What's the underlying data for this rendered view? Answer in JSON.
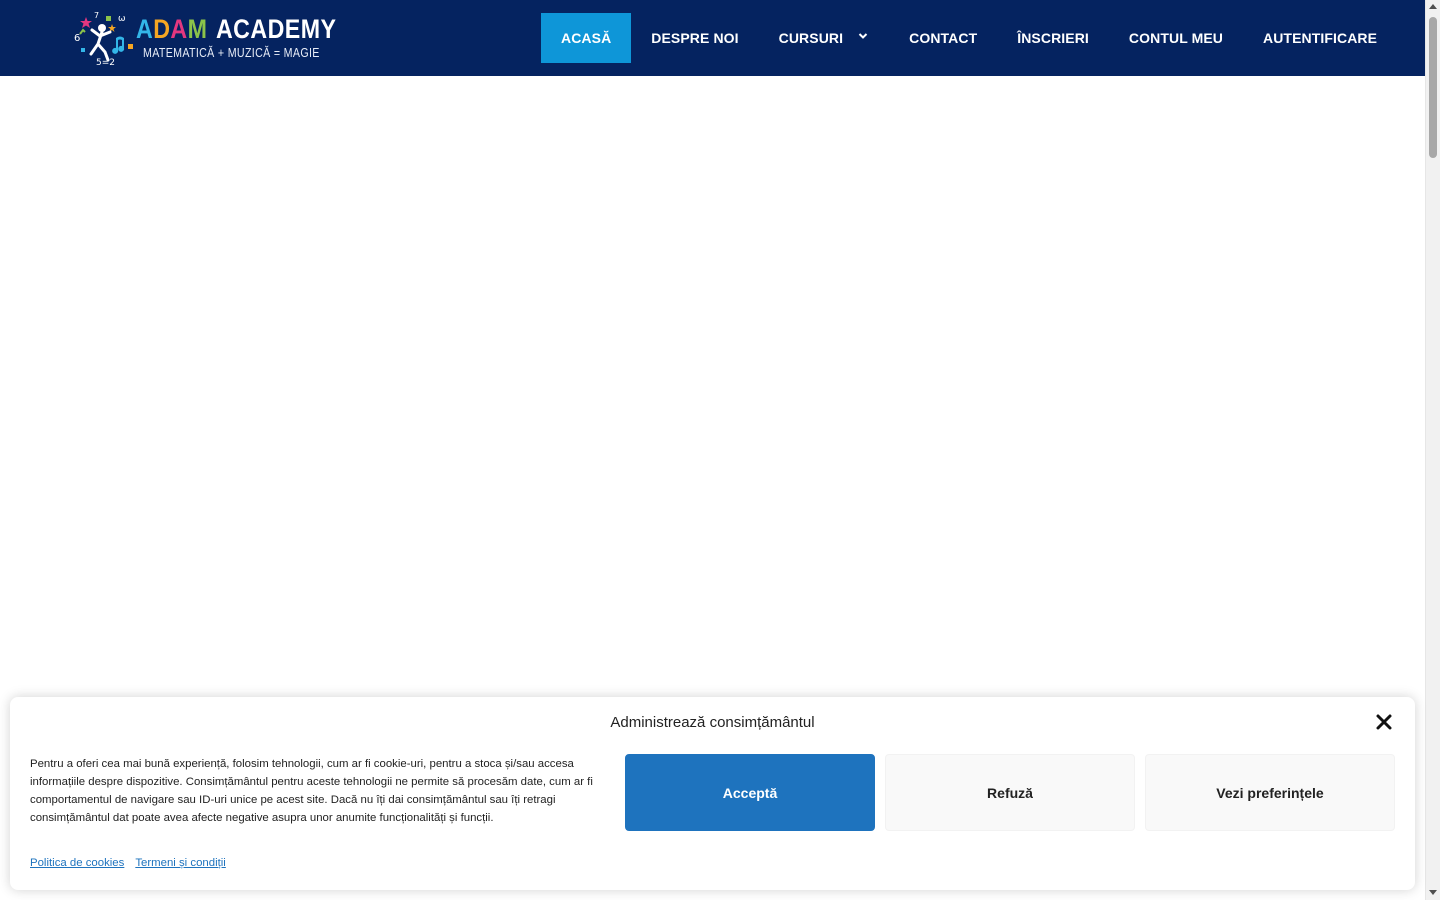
{
  "header": {
    "logo": {
      "title_adam": [
        "A",
        "D",
        "A",
        "M"
      ],
      "title_academy": "ACADEMY",
      "tagline": "MATEMATICĂ + MUZICĂ = MAGIE"
    },
    "nav": [
      {
        "label": "ACASĂ",
        "active": true
      },
      {
        "label": "DESPRE NOI"
      },
      {
        "label": "CURSURI",
        "has_dropdown": true
      },
      {
        "label": "CONTACT"
      },
      {
        "label": "ÎNSCRIERI"
      },
      {
        "label": "CONTUL MEU"
      },
      {
        "label": "AUTENTIFICARE"
      }
    ]
  },
  "consent": {
    "title": "Administrează consimțământul",
    "text": "Pentru a oferi cea mai bună experiență, folosim tehnologii, cum ar fi cookie-uri, pentru a stoca și/sau accesa informațiile despre dispozitive. Consimțământul pentru aceste tehnologii ne permite să procesăm date, cum ar fi comportamentul de navigare sau ID-uri unice pe acest site. Dacă nu îți dai consimțământul sau îți retragi consimțământul dat poate avea afecte negative asupra unor anumite funcționalități și funcții.",
    "accept_label": "Acceptă",
    "refuse_label": "Refuză",
    "prefs_label": "Vezi preferințele",
    "links": [
      {
        "label": "Politica de cookies"
      },
      {
        "label": "Termeni și condiții"
      }
    ]
  },
  "colors": {
    "header_bg": "#052360",
    "nav_active": "#0e96d8",
    "accept_button": "#1e73be"
  }
}
